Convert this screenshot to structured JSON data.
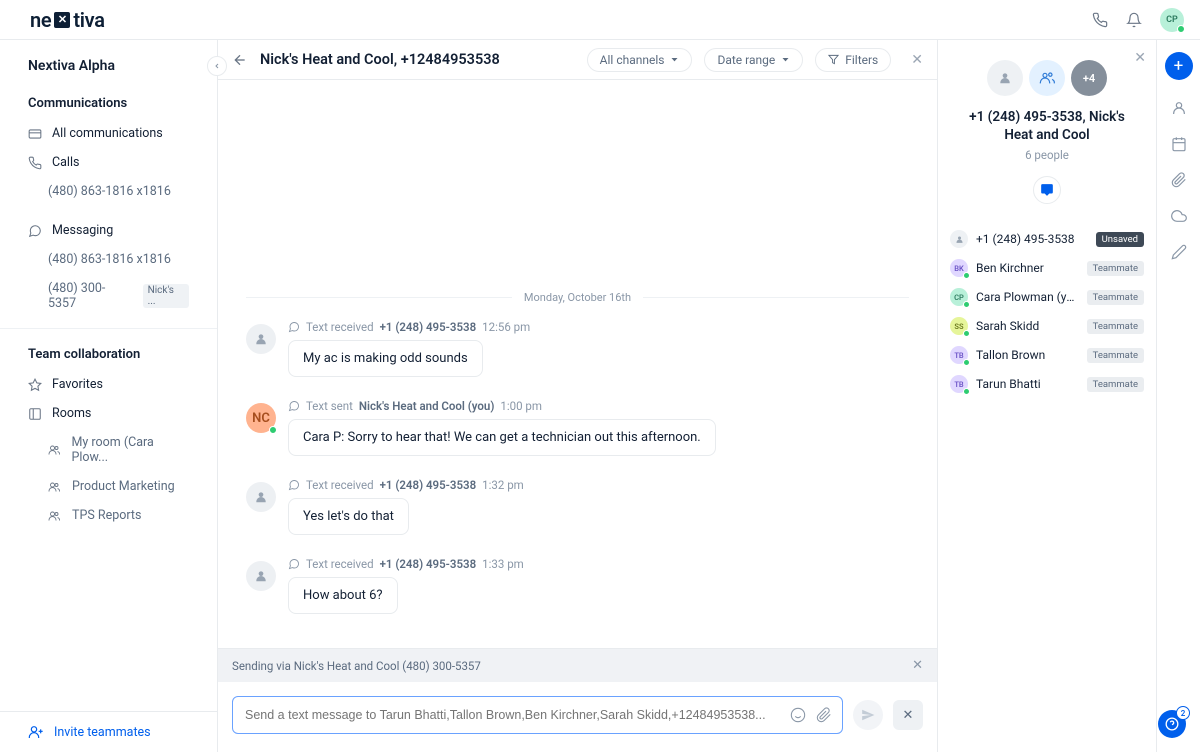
{
  "brand": "nextiva",
  "topbar": {
    "user_initials": "CP"
  },
  "sidebar": {
    "workspace": "Nextiva Alpha",
    "sections": {
      "communications": "Communications",
      "team": "Team collaboration"
    },
    "items": {
      "all": "All communications",
      "calls": "Calls",
      "calls_num": "(480) 863-1816 x1816",
      "messaging": "Messaging",
      "msg_num1": "(480) 863-1816 x1816",
      "msg_num2": "(480) 300-5357",
      "msg_num2_tag": "Nick's ...",
      "favorites": "Favorites",
      "rooms": "Rooms",
      "room1": "My room (Cara Plow...",
      "room2": "Product Marketing",
      "room3": "TPS Reports"
    },
    "invite": "Invite teammates"
  },
  "conversation": {
    "title": "Nick's Heat and Cool, +12484953538",
    "filters": {
      "channels": "All channels",
      "date": "Date range",
      "filters": "Filters"
    },
    "date_separator": "Monday, October 16th",
    "messages": [
      {
        "kind": "received",
        "kind_label": "Text received",
        "who": "+1 (248) 495-3538",
        "time": "12:56 pm",
        "text": "My ac is making odd sounds",
        "avatar_type": "generic"
      },
      {
        "kind": "sent",
        "kind_label": "Text sent",
        "who": "Nick's Heat and Cool (you)",
        "time": "1:00 pm",
        "text": "Cara P: Sorry to hear that! We can get a technician out this afternoon.",
        "avatar_type": "initials",
        "avatar_initials": "NC"
      },
      {
        "kind": "received",
        "kind_label": "Text received",
        "who": "+1 (248) 495-3538",
        "time": "1:32 pm",
        "text": "Yes let's do that",
        "avatar_type": "generic"
      },
      {
        "kind": "received",
        "kind_label": "Text received",
        "who": "+1 (248) 495-3538",
        "time": "1:33 pm",
        "text": "How about 6?",
        "avatar_type": "generic"
      }
    ],
    "sending_via": "Sending via Nick's Heat and Cool (480) 300-5357",
    "composer_placeholder": "Send a text message to Tarun Bhatti,Tallon Brown,Ben Kirchner,Sarah Skidd,+12484953538..."
  },
  "details": {
    "more_count": "+4",
    "title": "+1 (248) 495-3538, Nick's Heat and Cool",
    "people_count": "6 people",
    "contacts": [
      {
        "name": "+1 (248) 495-3538",
        "badge": "Unsaved",
        "badge_style": "dark",
        "av_bg": "#eef1f4",
        "av_color": "#98a4b2",
        "initials": "",
        "presence": false,
        "icon": "person"
      },
      {
        "name": "Ben Kirchner",
        "badge": "Teammate",
        "badge_style": "light",
        "av_bg": "#e0d7ff",
        "av_color": "#6b53c7",
        "initials": "BK",
        "presence": true
      },
      {
        "name": "Cara Plowman (you)",
        "badge": "Teammate",
        "badge_style": "light",
        "av_bg": "#b8f0d9",
        "av_color": "#2b7a5e",
        "initials": "CP",
        "presence": true
      },
      {
        "name": "Sarah Skidd",
        "badge": "Teammate",
        "badge_style": "light",
        "av_bg": "#e6f59a",
        "av_color": "#6b7a1e",
        "initials": "SS",
        "presence": true
      },
      {
        "name": "Tallon Brown",
        "badge": "Teammate",
        "badge_style": "light",
        "av_bg": "#e0d7ff",
        "av_color": "#6b53c7",
        "initials": "TB",
        "presence": true
      },
      {
        "name": "Tarun Bhatti",
        "badge": "Teammate",
        "badge_style": "light",
        "av_bg": "#e0d7ff",
        "av_color": "#6b53c7",
        "initials": "TB",
        "presence": true
      }
    ]
  },
  "help_badge": "2"
}
